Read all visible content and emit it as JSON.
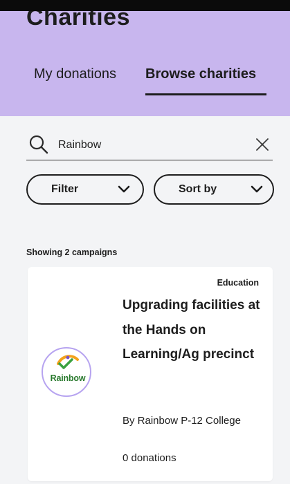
{
  "header": {
    "title": "Charities",
    "tabs": [
      {
        "label": "My donations",
        "active": false
      },
      {
        "label": "Browse charities",
        "active": true
      }
    ],
    "bg_color": "#c8b6ee"
  },
  "search": {
    "value": "Rainbow",
    "placeholder": ""
  },
  "filters": {
    "filter_label": "Filter",
    "sort_label": "Sort by"
  },
  "results": {
    "summary": "Showing 2 campaigns",
    "items": [
      {
        "category": "Education",
        "title": "Upgrading facilities at the Hands on Learning/Ag precinct",
        "org": "By Rainbow P-12 College",
        "donations": "0 donations",
        "logo_text": "Rainbow"
      }
    ]
  },
  "icons": {
    "search": "search-icon",
    "clear": "close-icon",
    "dropdown": "chevron-down-icon"
  }
}
